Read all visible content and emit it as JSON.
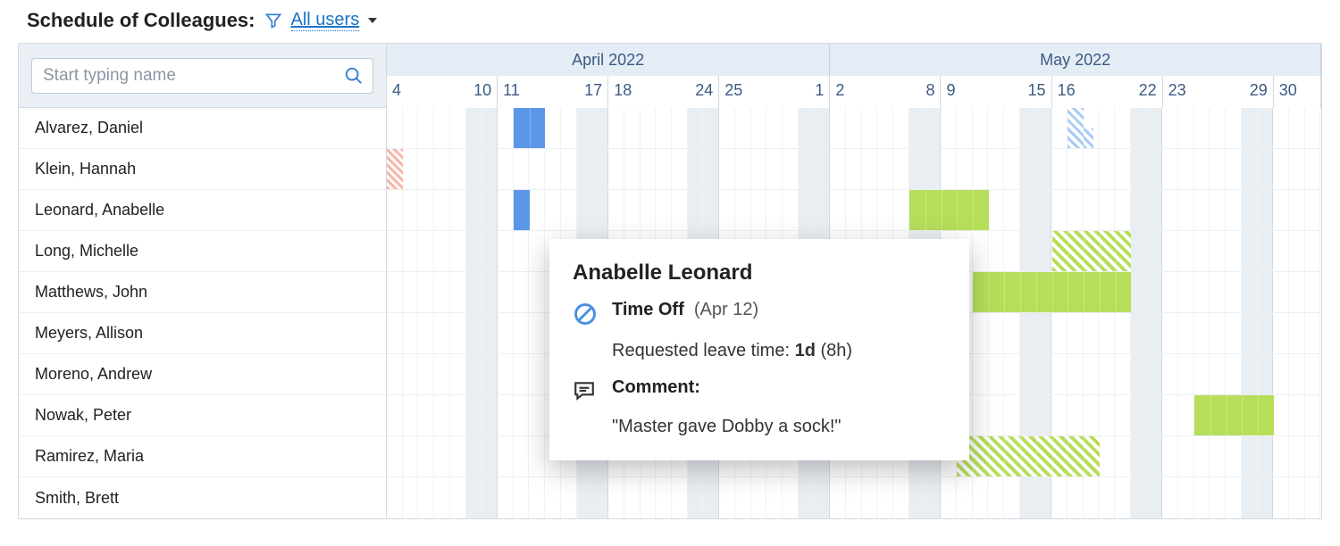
{
  "header": {
    "title": "Schedule of Colleagues:",
    "filter_label": "All users"
  },
  "search": {
    "placeholder": "Start typing name"
  },
  "employees": [
    "Alvarez, Daniel",
    "Klein, Hannah",
    "Leonard, Anabelle",
    "Long, Michelle",
    "Matthews, John",
    "Meyers, Allison",
    "Moreno, Andrew",
    "Nowak, Peter",
    "Ramirez, Maria",
    "Smith, Brett"
  ],
  "calendar": {
    "months": [
      {
        "label": "April 2022",
        "weeks": 4
      },
      {
        "label": "May 2022",
        "weeks": 4.43
      }
    ],
    "week_numbers": [
      {
        "left": "4",
        "right": "10"
      },
      {
        "left": "11",
        "right": "17"
      },
      {
        "left": "18",
        "right": "24"
      },
      {
        "left": "25",
        "right": "1"
      },
      {
        "left": "2",
        "right": "8"
      },
      {
        "left": "9",
        "right": "15"
      },
      {
        "left": "16",
        "right": "22"
      },
      {
        "left": "23",
        "right": "29"
      },
      {
        "left": "30",
        "right": ""
      }
    ],
    "days_shown": 59,
    "weekend_day_indices": [
      5,
      6,
      12,
      13,
      19,
      20,
      26,
      27,
      33,
      34,
      40,
      41,
      47,
      48,
      54,
      55
    ]
  },
  "events": [
    {
      "row": 0,
      "start": 8,
      "len": 2,
      "cls": "ev-blue"
    },
    {
      "row": 0,
      "start": 43,
      "len": 1,
      "cls": "ev-blue-hatch",
      "shape": "L"
    },
    {
      "row": 1,
      "start": 0,
      "len": 1,
      "cls": "ev-red-hatch"
    },
    {
      "row": 2,
      "start": 8,
      "len": 1,
      "cls": "ev-blue"
    },
    {
      "row": 2,
      "start": 33,
      "len": 5,
      "cls": "ev-green"
    },
    {
      "row": 3,
      "start": 42,
      "len": 5,
      "cls": "ev-green-hatch"
    },
    {
      "row": 4,
      "start": 37,
      "len": 10,
      "cls": "ev-green"
    },
    {
      "row": 7,
      "start": 51,
      "len": 5,
      "cls": "ev-green"
    },
    {
      "row": 8,
      "start": 36,
      "len": 9,
      "cls": "ev-green-hatch"
    }
  ],
  "tooltip": {
    "name": "Anabelle Leonard",
    "type_label": "Time Off",
    "date": "(Apr 12)",
    "requested_prefix": "Requested leave time:",
    "requested_value": "1d",
    "requested_suffix": "(8h)",
    "comment_label": "Comment:",
    "comment_text": "\"Master gave Dobby a sock!\""
  }
}
